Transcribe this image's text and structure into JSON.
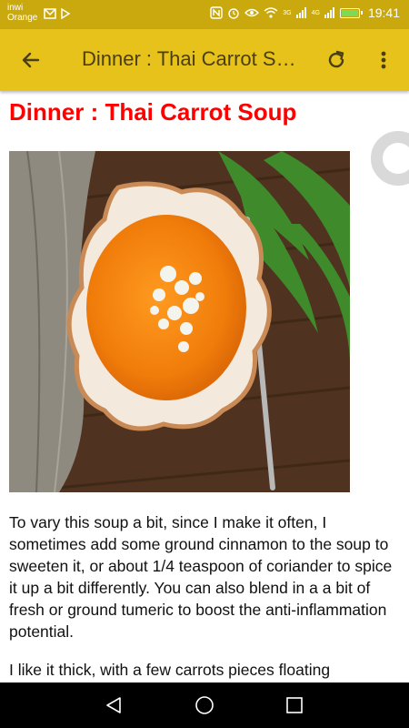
{
  "status_bar": {
    "carrier_line1": "inwi",
    "carrier_line2": "Orange",
    "time": "19:41",
    "network_3g": "3G",
    "network_4g": "4G"
  },
  "app_bar": {
    "title": "Dinner : Thai Carrot Soup"
  },
  "article": {
    "heading": "Dinner : Thai Carrot Soup",
    "paragraphs": [
      "To vary this soup a bit, since I make it often, I sometimes add some ground cinnamon to the soup to sweeten it, or about 1/4 teaspoon of coriander to spice it up a bit differently. You can also blend in a a bit of fresh or ground tumeric to boost the anti-inflammation potential.",
      "I like it thick, with a few carrots pieces floating"
    ]
  },
  "colors": {
    "status_bar": "#c9a90e",
    "app_bar": "#e6c21a",
    "heading": "#ff0000"
  }
}
